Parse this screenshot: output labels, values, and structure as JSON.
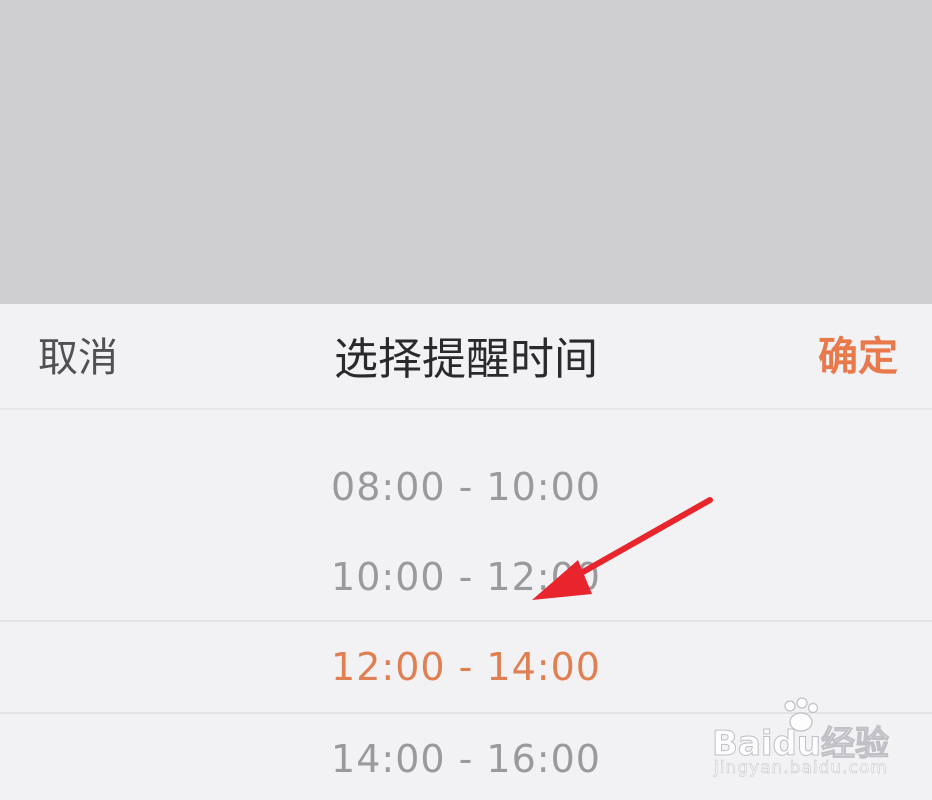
{
  "sheet": {
    "cancel_label": "取消",
    "title": "选择提醒时间",
    "confirm_label": "确定"
  },
  "picker": {
    "options": [
      "08:00 - 10:00",
      "10:00 - 12:00",
      "12:00 - 14:00",
      "14:00 - 16:00"
    ],
    "selected_index": 2
  },
  "watermark": {
    "brand": "Baidu经验",
    "sub": "jingyan.baidu.com"
  },
  "colors": {
    "accent": "#e9784a",
    "selected_text": "#e07f52",
    "annotation_arrow": "#e8252c",
    "overlay": "#cfcfd1",
    "sheet_bg": "#f2f2f4"
  },
  "icons": {
    "annotation": "red-arrow-icon",
    "watermark_logo": "baidu-paw-icon"
  }
}
